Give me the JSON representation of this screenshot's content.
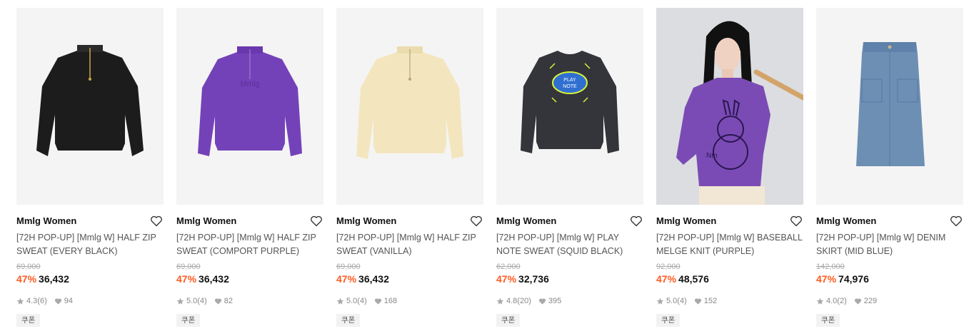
{
  "products": [
    {
      "brand": "Mmlg Women",
      "title": "[72H POP-UP] [Mmlg W] HALF ZIP SWEAT (EVERY BLACK)",
      "original_price": "69,000",
      "discount": "47%",
      "price": "36,432",
      "rating": "4.3",
      "reviews": "(6)",
      "likes": "94",
      "coupon": "쿠폰",
      "item": "black-halfzip",
      "color": "#1c1c1c"
    },
    {
      "brand": "Mmlg Women",
      "title": "[72H POP-UP] [Mmlg W] HALF ZIP SWEAT (COMPORT PURPLE)",
      "original_price": "69,000",
      "discount": "47%",
      "price": "36,432",
      "rating": "5.0",
      "reviews": "(4)",
      "likes": "82",
      "coupon": "쿠폰",
      "item": "purple-halfzip",
      "color": "#7442b8"
    },
    {
      "brand": "Mmlg Women",
      "title": "[72H POP-UP] [Mmlg W] HALF ZIP SWEAT (VANILLA)",
      "original_price": "69,000",
      "discount": "47%",
      "price": "36,432",
      "rating": "5.0",
      "reviews": "(4)",
      "likes": "168",
      "coupon": "쿠폰",
      "item": "vanilla-halfzip",
      "color": "#f3e6be"
    },
    {
      "brand": "Mmlg Women",
      "title": "[72H POP-UP] [Mmlg W] PLAY NOTE SWEAT (SQUID BLACK)",
      "original_price": "62,000",
      "discount": "47%",
      "price": "32,736",
      "rating": "4.8",
      "reviews": "(20)",
      "likes": "395",
      "coupon": "쿠폰",
      "item": "squid-black-sweat",
      "color": "#33353a"
    },
    {
      "brand": "Mmlg Women",
      "title": "[72H POP-UP] [Mmlg W] BASEBALL MELGE KNIT (PURPLE)",
      "original_price": "92,000",
      "discount": "47%",
      "price": "48,576",
      "rating": "5.0",
      "reviews": "(4)",
      "likes": "152",
      "coupon": "쿠폰",
      "item": "model-knit",
      "color": "#7b4bb5"
    },
    {
      "brand": "Mmlg Women",
      "title": "[72H POP-UP] [Mmlg W] DENIM SKIRT (MID BLUE)",
      "original_price": "142,000",
      "discount": "47%",
      "price": "74,976",
      "rating": "4.0",
      "reviews": "(2)",
      "likes": "229",
      "coupon": "쿠폰",
      "item": "denim-skirt",
      "color": "#6e8fb4"
    }
  ],
  "colors": {
    "discount": "#ff5a1f",
    "thumb_bg": "#f4f4f4",
    "coupon_bg": "#f2f2f2"
  },
  "icons": {
    "wishlist": "heart-outline-icon",
    "rating": "star-icon",
    "likes": "heart-filled-icon"
  }
}
